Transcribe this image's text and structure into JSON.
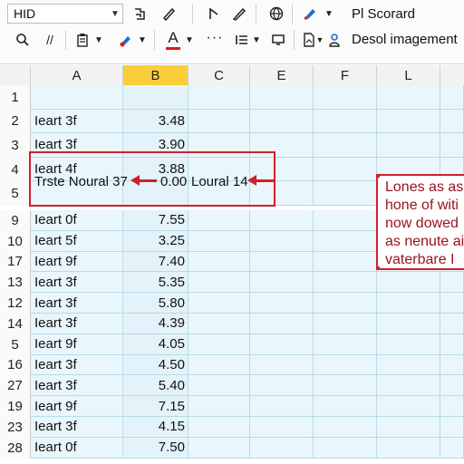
{
  "toolbar": {
    "font_name": "HID",
    "font_dropdown_icon": "chevron-down-icon",
    "row1_icons": [
      "paste-icon",
      "format-painter-icon",
      "cursor-icon",
      "pen-icon",
      "globe-icon",
      "highlighter-icon"
    ],
    "row1_right_label": "Pl Scorard",
    "row2_icons": [
      "search-icon",
      "slash-icon",
      "clipboard-icon",
      "fill-color-icon",
      "font-color-icon",
      "more-icon",
      "list-icon",
      "rectangle-icon",
      "document-icon",
      "person-icon"
    ],
    "row2_right_label": "Desol imagement",
    "accent_red": "#d32020",
    "accent_blue": "#1f6fd0"
  },
  "columns": [
    "A",
    "B",
    "C",
    "E",
    "F",
    "L"
  ],
  "selected_column": "B",
  "rows_top": [
    {
      "num": "1",
      "a": "",
      "b": ""
    },
    {
      "num": "2",
      "a": "Ieart 3f",
      "b": "3.48"
    },
    {
      "num": "3",
      "a": "Ieart 3f",
      "b": "3.90"
    },
    {
      "num": "4",
      "a": "Ieart 4f",
      "b": "3.88"
    },
    {
      "num": "5",
      "a": "",
      "b": ""
    }
  ],
  "row5_annotation": {
    "left_text": "Trste Noural 37",
    "right_value": "0.00",
    "right_text": "Loural 14"
  },
  "rows_bottom": [
    {
      "num": "9",
      "a": "Ieart 0f",
      "b": "7.55"
    },
    {
      "num": "10",
      "a": "Ieart 5f",
      "b": "3.25"
    },
    {
      "num": "17",
      "a": "Ieart 9f",
      "b": "7.40"
    },
    {
      "num": "13",
      "a": "Ieart 3f",
      "b": "5.35"
    },
    {
      "num": "12",
      "a": "Ieart 3f",
      "b": "5.80"
    },
    {
      "num": "14",
      "a": "Ieart 3f",
      "b": "4.39"
    },
    {
      "num": "5",
      "a": "Ieart 9f",
      "b": "4.05"
    },
    {
      "num": "16",
      "a": "Ieart 3f",
      "b": "4.50"
    },
    {
      "num": "27",
      "a": "Ieart 3f",
      "b": "5.40"
    },
    {
      "num": "19",
      "a": "Ieart 9f",
      "b": "7.15"
    },
    {
      "num": "23",
      "a": "Ieart 3f",
      "b": "4.15"
    },
    {
      "num": "28",
      "a": "Ieart 0f",
      "b": "7.50"
    }
  ],
  "note": {
    "lines": [
      "Lones as as",
      "hone of witi",
      "now dowed",
      "as nenute ai",
      "vaterbare I"
    ]
  }
}
